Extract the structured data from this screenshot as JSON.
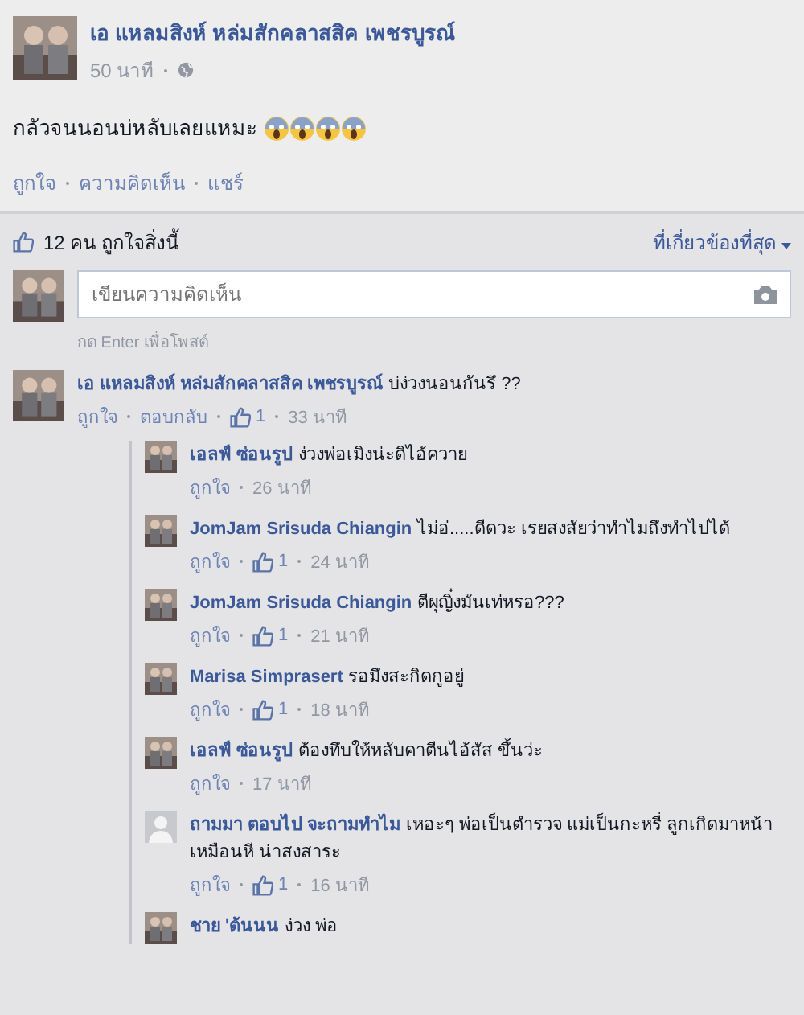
{
  "post": {
    "author": "เอ แหลมสิงห์ หล่มสักคลาสสิค เพชรบูรณ์",
    "time": "50 นาที",
    "text": "กลัวจนนอนบ่หลับเลยแหมะ",
    "emojis": [
      {
        "kind": "scream"
      },
      {
        "kind": "scream"
      },
      {
        "kind": "scream"
      },
      {
        "kind": "scream"
      }
    ],
    "actions": [
      "ถูกใจ",
      "ความคิดเห็น",
      "แชร์"
    ]
  },
  "likes_summary": "12 คน ถูกใจสิ่งนี้",
  "sort": "ที่เกี่ยวข้องที่สุด",
  "comment_box": {
    "placeholder": "เขียนความคิดเห็น",
    "hint": "กด Enter เพื่อโพสต์"
  },
  "comments": [
    {
      "author": "เอ แหลมสิงห์ หล่มสักคลาสสิค เพชรบูรณ์",
      "text": "บ่ง่วงนอนกันรึ ??",
      "avatar": {
        "kind": "picture"
      },
      "actions": [
        "ถูกใจ",
        "ตอบกลับ"
      ],
      "likes": "1",
      "time": "33 นาที",
      "children": [
        {
          "author": "เอลฟ์ ซ่อนรูป",
          "text": "ง่วงพ่อเมิงน่ะดิไอ้ควาย",
          "avatar": {
            "kind": "picture"
          },
          "actions": [
            "ถูกใจ"
          ],
          "time": "26 นาที"
        },
        {
          "author": "JomJam Srisuda Chiangin",
          "text": "ไม่อ่.....ดีดวะ เรยสงสัยว่าทำไมถึงทำไปได้",
          "avatar": {
            "kind": "picture"
          },
          "actions": [
            "ถูกใจ"
          ],
          "likes": "1",
          "time": "24 นาที"
        },
        {
          "author": "JomJam Srisuda Chiangin",
          "text": "ตีผุญิ๋งมันเท่หรอ???",
          "avatar": {
            "kind": "picture"
          },
          "actions": [
            "ถูกใจ"
          ],
          "likes": "1",
          "time": "21 นาที"
        },
        {
          "author": "Marisa Simprasert",
          "text": "รอมึงสะกิดกูอยู่",
          "avatar": {
            "kind": "picture"
          },
          "actions": [
            "ถูกใจ"
          ],
          "likes": "1",
          "time": "18 นาที"
        },
        {
          "author": "เอลฟ์ ซ่อนรูป",
          "text": "ต้องทึบให้หลับคาตีนไอ้สัส ขึ้นว่ะ",
          "avatar": {
            "kind": "picture"
          },
          "actions": [
            "ถูกใจ"
          ],
          "time": "17 นาที"
        },
        {
          "author": "ถามมา ตอบไป จะถามทำไม",
          "text": "เหอะๆ พ่อเป็นตำรวจ แม่เป็นกะหรี่ ลูกเกิดมาหน้าเหมือนหี น่าสงสาระ",
          "avatar": {
            "kind": "default"
          },
          "actions": [
            "ถูกใจ"
          ],
          "likes": "1",
          "time": "16 นาที"
        },
        {
          "author": "ชาย 'ต้นนน",
          "text": "ง่วง พ่อ",
          "avatar": {
            "kind": "picture"
          }
        }
      ]
    }
  ]
}
